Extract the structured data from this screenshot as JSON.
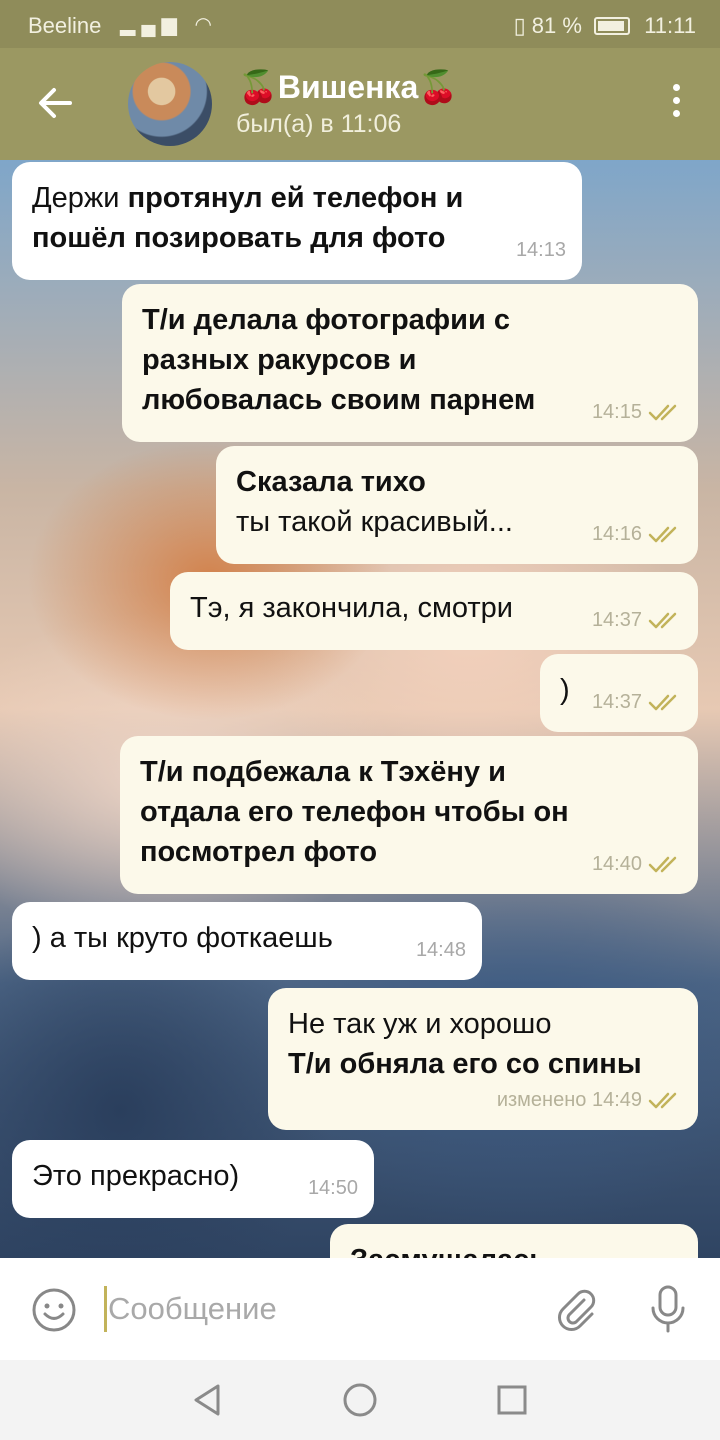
{
  "status_bar": {
    "carrier": "Beeline",
    "battery_percent": "81 %",
    "time": "11:11"
  },
  "header": {
    "title": "🍒Вишенка🍒",
    "status": "был(а) в 11:06"
  },
  "messages": [
    {
      "dir": "in",
      "parts": [
        {
          "text": "Держи ",
          "bold": false
        },
        {
          "text": "протянул ей телефон и пошёл позировать для фото",
          "bold": true
        }
      ],
      "time": "14:13"
    },
    {
      "dir": "out",
      "parts": [
        {
          "text": "Т/и делала фотографии с разных ракурсов и любовалась своим парнем",
          "bold": true
        }
      ],
      "time": "14:15"
    },
    {
      "dir": "out",
      "parts": [
        {
          "text": "Сказала тихо",
          "bold": true
        },
        {
          "text": "ты такой красивый...",
          "bold": false
        }
      ],
      "time": "14:16"
    },
    {
      "dir": "out",
      "parts": [
        {
          "text": "Тэ, я закончила, смотри",
          "bold": false
        }
      ],
      "time": "14:37"
    },
    {
      "dir": "out",
      "parts": [
        {
          "text": ")",
          "bold": false
        }
      ],
      "time": "14:37"
    },
    {
      "dir": "out",
      "parts": [
        {
          "text": "Т/и подбежала к Тэхёну и отдала его телефон чтобы он посмотрел фото",
          "bold": true
        }
      ],
      "time": "14:40"
    },
    {
      "dir": "in",
      "parts": [
        {
          "text": ") а ты круто фоткаешь",
          "bold": false
        }
      ],
      "time": "14:48"
    },
    {
      "dir": "out",
      "parts": [
        {
          "text": "Не так уж и хорошо",
          "bold": false
        },
        {
          "text": "Т/и обняла его со спины",
          "bold": true
        }
      ],
      "time": "изменено 14:49"
    },
    {
      "dir": "in",
      "parts": [
        {
          "text": "Это прекрасно)",
          "bold": false
        }
      ],
      "time": "14:50"
    },
    {
      "dir": "out",
      "parts": [
        {
          "text": "Засмущалась",
          "bold": true
        }
      ],
      "time": ""
    }
  ],
  "composer": {
    "placeholder": "Сообщение"
  },
  "colors": {
    "header": "#9b9862",
    "status_bar": "#8f8c5a",
    "outgoing_bubble": "#fcf9ea",
    "incoming_bubble": "#ffffff",
    "read_check": "#c2b35a"
  }
}
